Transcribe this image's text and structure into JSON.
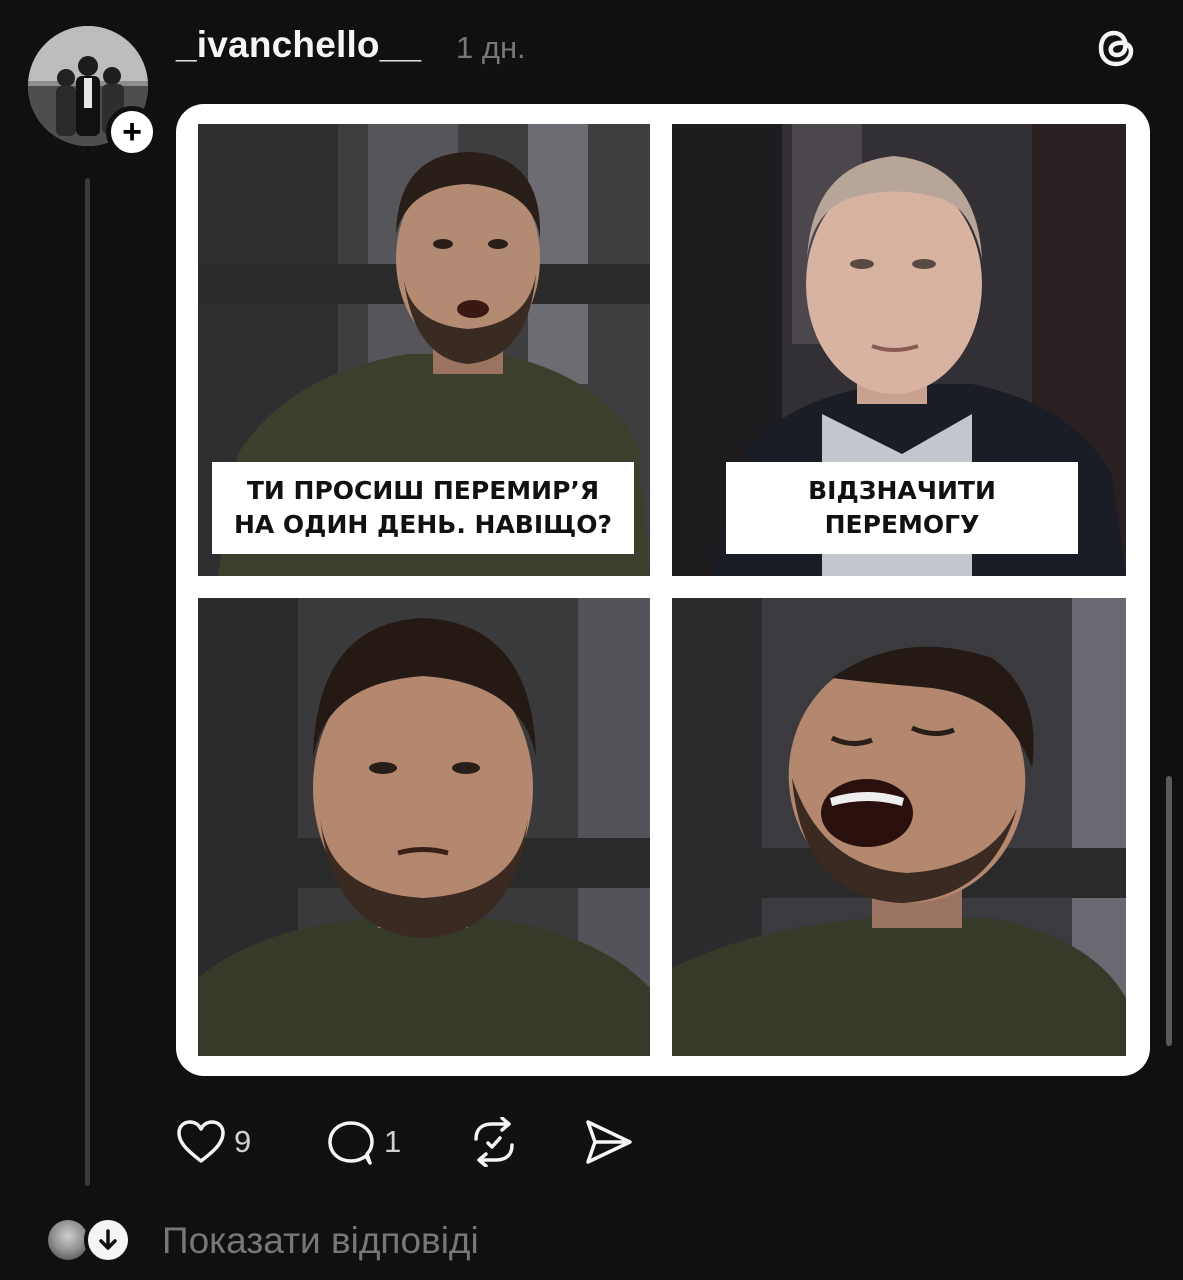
{
  "post": {
    "username": "_ivanchello__",
    "timestamp": "1 дн.",
    "avatar_icon": "profile-photo",
    "follow_icon": "plus-icon",
    "follow_glyph": "+",
    "brand_icon": "threads-logo-icon"
  },
  "meme": {
    "panel1_caption": "ТИ ПРОСИШ ПЕРЕМИР’Я НА ОДИН ДЕНЬ. НАВІЩО?",
    "panel2_caption": "ВІДЗНАЧИТИ ПЕРЕМОГУ"
  },
  "actions": {
    "like_icon": "heart-icon",
    "like_count": "9",
    "comment_icon": "comment-bubble-icon",
    "comment_count": "1",
    "repost_icon": "repost-icon",
    "share_icon": "send-icon"
  },
  "replies": {
    "label": "Показати відповіді",
    "expand_icon": "arrow-down-icon"
  },
  "colors": {
    "background": "#101010",
    "text_primary": "#f3f5f7",
    "text_secondary": "#777777",
    "thread_line": "#3a3a3a"
  }
}
